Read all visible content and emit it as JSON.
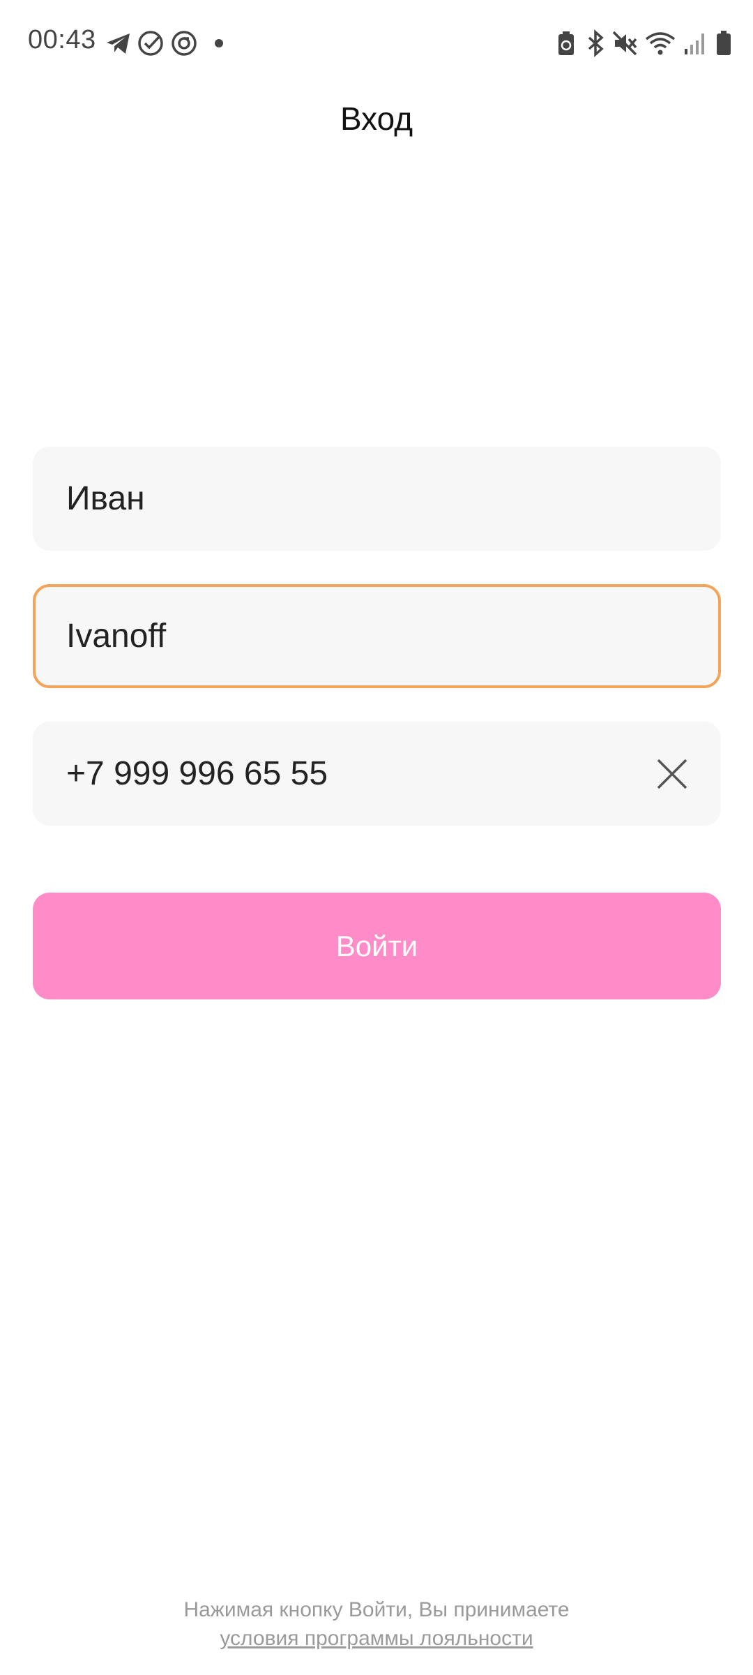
{
  "status_bar": {
    "time": "00:43",
    "left_icons": [
      "telegram-icon",
      "check-circle-icon",
      "sync-icon",
      "notification-dot-icon"
    ],
    "right_icons": [
      "battery-saver-icon",
      "bluetooth-icon",
      "mute-icon",
      "wifi-icon",
      "signal-icon",
      "battery-icon"
    ],
    "icon_color": "#444444"
  },
  "header": {
    "title": "Вход"
  },
  "form": {
    "first_name": {
      "value": "Иван"
    },
    "last_name": {
      "value": "Ivanoff",
      "focused": true
    },
    "phone": {
      "value": "+7 999 996 65 55",
      "clear_icon": "close-icon"
    }
  },
  "login_button": {
    "label": "Войти",
    "color": "#ff8cc8"
  },
  "footer": {
    "note": "Нажимая кнопку Войти, Вы принимаете",
    "link": "условия программы лояльности"
  },
  "colors": {
    "focus_border": "#f2a45a",
    "field_background": "#f7f7f7",
    "muted_text": "#9a9a9a"
  }
}
